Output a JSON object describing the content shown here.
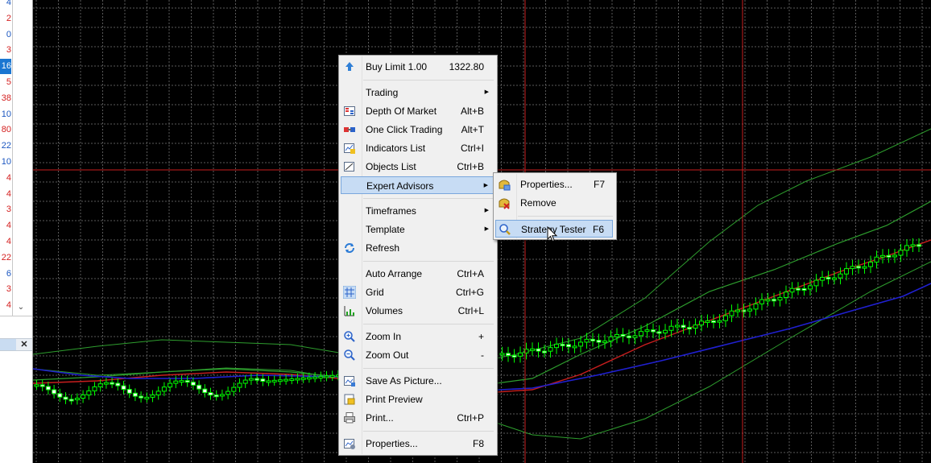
{
  "left_panel": {
    "ticks": [
      {
        "text": "4",
        "color": "#1a56c0"
      },
      {
        "text": "2",
        "color": "#d42020"
      },
      {
        "text": "0",
        "color": "#1a56c0"
      },
      {
        "text": "3",
        "color": "#d42020"
      },
      {
        "text": "16",
        "color": "#ffffff",
        "highlight": true
      },
      {
        "text": "5",
        "color": "#d42020"
      },
      {
        "text": "38",
        "color": "#d42020"
      },
      {
        "text": "10",
        "color": "#1a56c0"
      },
      {
        "text": "80",
        "color": "#d42020"
      },
      {
        "text": "22",
        "color": "#1a56c0"
      },
      {
        "text": "10",
        "color": "#1a56c0"
      },
      {
        "text": "4",
        "color": "#d42020"
      },
      {
        "text": "4",
        "color": "#d42020"
      },
      {
        "text": "3",
        "color": "#d42020"
      },
      {
        "text": "4",
        "color": "#d42020"
      },
      {
        "text": "4",
        "color": "#d42020"
      },
      {
        "text": "22",
        "color": "#d42020"
      },
      {
        "text": "6",
        "color": "#1a56c0"
      },
      {
        "text": "3",
        "color": "#d42020"
      },
      {
        "text": "4",
        "color": "#d42020"
      }
    ],
    "scroll_arrow": "⌄",
    "close_glyph": "✕"
  },
  "context_menu": {
    "items": [
      {
        "label": "Buy Limit 1.00",
        "shortcut": "1322.80",
        "icon": "buy-limit-icon"
      },
      {
        "label": "Trading",
        "submenu": true
      },
      {
        "label": "Depth Of Market",
        "shortcut": "Alt+B",
        "icon": "depth-of-market-icon"
      },
      {
        "label": "One Click Trading",
        "shortcut": "Alt+T",
        "icon": "one-click-trading-icon"
      },
      {
        "label": "Indicators List",
        "shortcut": "Ctrl+I",
        "icon": "indicators-list-icon"
      },
      {
        "label": "Objects List",
        "shortcut": "Ctrl+B",
        "icon": "objects-list-icon"
      },
      {
        "label": "Expert Advisors",
        "submenu": true,
        "selected": true
      },
      {
        "label": "Timeframes",
        "submenu": true
      },
      {
        "label": "Template",
        "submenu": true
      },
      {
        "label": "Refresh",
        "icon": "refresh-icon"
      },
      {
        "label": "Auto Arrange",
        "shortcut": "Ctrl+A"
      },
      {
        "label": "Grid",
        "shortcut": "Ctrl+G",
        "icon": "grid-icon"
      },
      {
        "label": "Volumes",
        "shortcut": "Ctrl+L",
        "icon": "volumes-icon"
      },
      {
        "label": "Zoom In",
        "shortcut": "+",
        "icon": "zoom-in-icon"
      },
      {
        "label": "Zoom Out",
        "shortcut": "-",
        "icon": "zoom-out-icon"
      },
      {
        "label": "Save As Picture...",
        "icon": "save-picture-icon"
      },
      {
        "label": "Print Preview",
        "icon": "print-preview-icon"
      },
      {
        "label": "Print...",
        "shortcut": "Ctrl+P",
        "icon": "print-icon"
      },
      {
        "label": "Properties...",
        "shortcut": "F8",
        "icon": "properties-icon"
      }
    ]
  },
  "expert_submenu": {
    "items": [
      {
        "label": "Properties...",
        "shortcut": "F7",
        "icon": "expert-properties-icon"
      },
      {
        "label": "Remove",
        "icon": "expert-remove-icon"
      },
      {
        "label": "Strategy Tester",
        "shortcut": "F6",
        "icon": "strategy-tester-icon",
        "selected": true
      }
    ]
  },
  "colors": {
    "background": "#000000",
    "grid": "#5a5a5a",
    "crosshair": "#c81e1e",
    "candle": "#00ff00",
    "band": "#2e9e2e",
    "ma_red": "#c81e1e",
    "ma_blue": "#2020d0"
  }
}
